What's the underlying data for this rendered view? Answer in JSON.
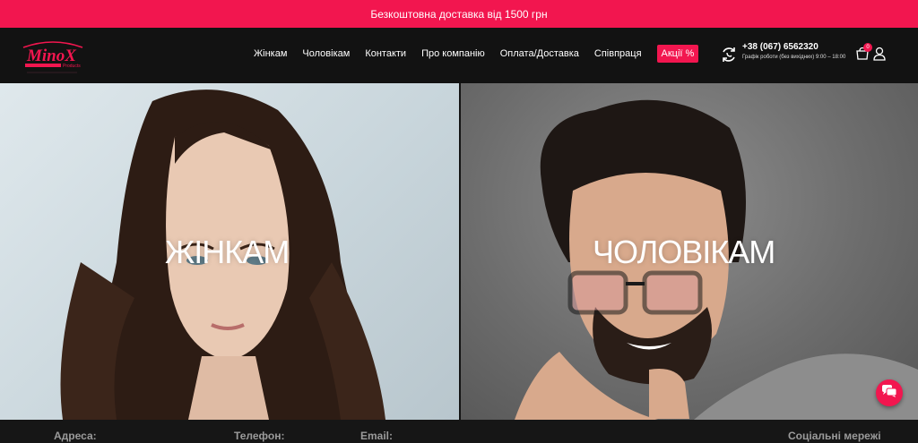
{
  "promo": {
    "text": "Безкоштовна доставка від 1500 грн"
  },
  "logo": {
    "name": "MinoX",
    "tagline": "Products",
    "icon": "minox-logo"
  },
  "nav": {
    "items": [
      {
        "label": "Жінкам"
      },
      {
        "label": "Чоловікам"
      },
      {
        "label": "Контакти"
      },
      {
        "label": "Про компанію"
      },
      {
        "label": "Оплата/Доставка"
      },
      {
        "label": "Співпраця"
      },
      {
        "label": "Акції %"
      }
    ]
  },
  "contact": {
    "phone": "+38 (067) 6562320",
    "hours": "Графік роботи (без вихідних) 9:00 – 18:00",
    "icon": "phone-refresh-icon"
  },
  "cart": {
    "count": "0",
    "icon": "cart-icon"
  },
  "user": {
    "icon": "user-icon"
  },
  "hero": {
    "women": {
      "title": "ЖІНКАМ"
    },
    "men": {
      "title": "ЧОЛОВІКАМ"
    }
  },
  "chat": {
    "icon": "chat-icon"
  },
  "footer": {
    "address_label": "Адреса:",
    "phone_label": "Телефон:",
    "email_label": "Email:",
    "social_label": "Соціальні мережі"
  },
  "colors": {
    "accent": "#f2164f",
    "header_bg": "#121212",
    "footer_text": "#9b9b9b"
  }
}
